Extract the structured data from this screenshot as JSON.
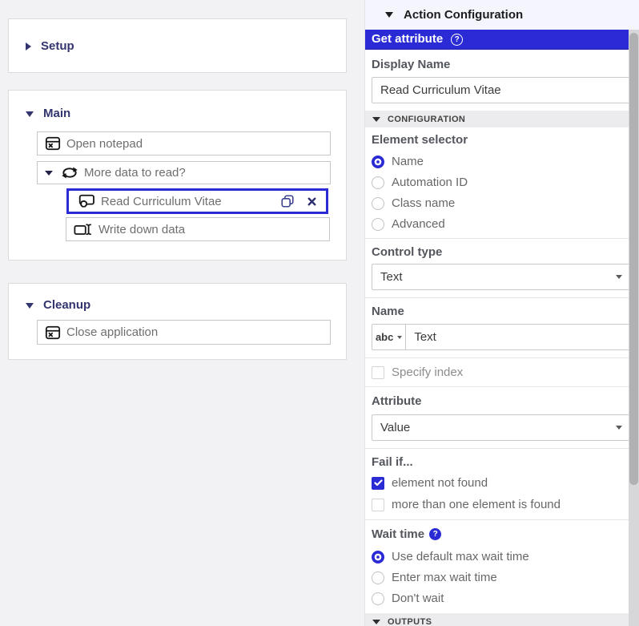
{
  "colors": {
    "accent": "#2b2bd6",
    "group_title": "#33356e",
    "checked_blue": "#2b2bd6"
  },
  "icons": {
    "question_glyph": "?"
  },
  "left": {
    "groups": [
      {
        "label": "Setup",
        "collapsed": true,
        "nodes": []
      },
      {
        "label": "Main",
        "collapsed": false,
        "nodes": [
          {
            "label": "Open notepad",
            "icon": "app-window-close-icon"
          },
          {
            "label": "More data to read?",
            "icon": "loop-icon",
            "expandable": true
          },
          {
            "label": "Read Curriculum Vitae",
            "icon": "element-capture-icon",
            "selected": true
          },
          {
            "label": "Write down data",
            "icon": "type-text-icon"
          }
        ]
      },
      {
        "label": "Cleanup",
        "collapsed": false,
        "nodes": [
          {
            "label": "Close application",
            "icon": "app-window-close-icon"
          }
        ]
      }
    ]
  },
  "panel": {
    "header": {
      "title": "Action Configuration"
    },
    "action": {
      "title": "Get attribute",
      "help_icon": "help-circle-icon"
    },
    "display_name": {
      "label": "Display Name",
      "value": "Read Curriculum Vitae"
    },
    "configuration_bar": {
      "label": "CONFIGURATION"
    },
    "element_selector": {
      "label": "Element selector",
      "options": [
        {
          "label": "Name",
          "selected": true
        },
        {
          "label": "Automation ID",
          "selected": false
        },
        {
          "label": "Class name",
          "selected": false
        },
        {
          "label": "Advanced",
          "selected": false
        }
      ]
    },
    "control_type": {
      "label": "Control type",
      "value": "Text"
    },
    "name_field": {
      "label": "Name",
      "prefix": "abc",
      "value": "Text"
    },
    "specify_index": {
      "label": "Specify index",
      "checked": false
    },
    "attribute": {
      "label": "Attribute",
      "value": "Value"
    },
    "fail_if": {
      "label": "Fail if...",
      "options": [
        {
          "label": "element not found",
          "checked": true
        },
        {
          "label": "more than one element is found",
          "checked": false
        }
      ]
    },
    "wait_time": {
      "label": "Wait time",
      "options": [
        {
          "label": "Use default max wait time",
          "selected": true
        },
        {
          "label": "Enter max wait time",
          "selected": false
        },
        {
          "label": "Don't wait",
          "selected": false
        }
      ]
    },
    "outputs_bar": {
      "label": "OUTPUTS"
    }
  }
}
